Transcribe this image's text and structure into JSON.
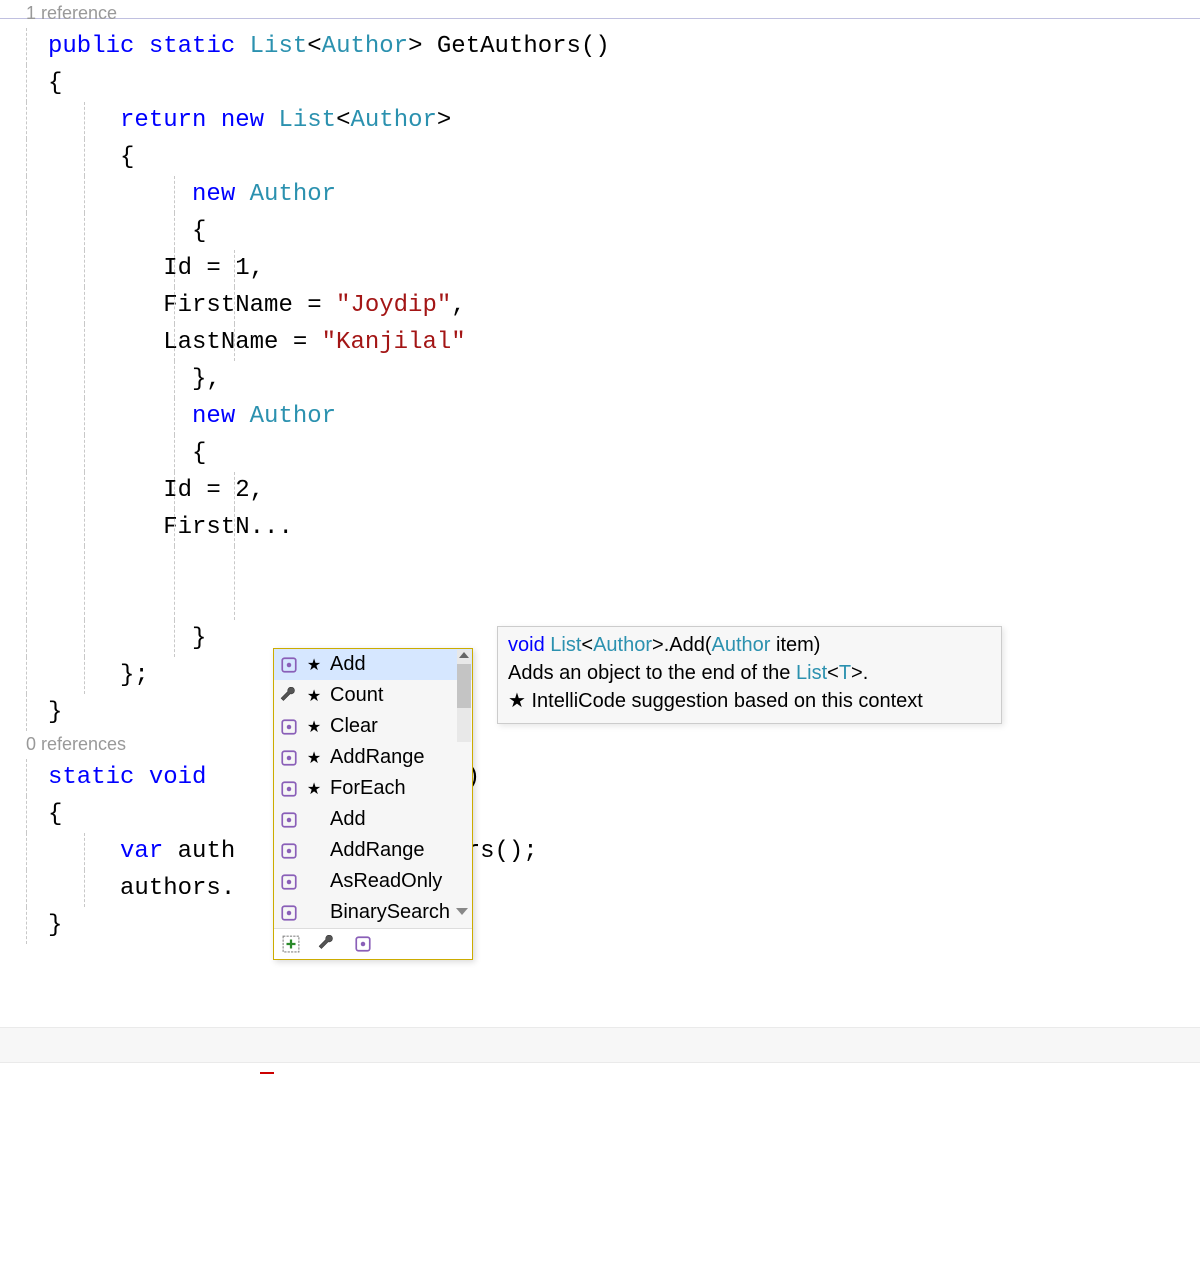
{
  "codelens": {
    "refs1": "1 reference",
    "refs0": "0 references"
  },
  "code": {
    "l1_public": "public",
    "l1_static": "static",
    "l1_list": "List",
    "l1_lt": "<",
    "l1_author": "Author",
    "l1_gt": ">",
    "l1_method": " GetAuthors()",
    "brace_open": "{",
    "brace_close": "}",
    "return": "return",
    "new": "new",
    "list": "List",
    "author": "Author",
    "id1": "        Id = 1,",
    "fn_label": "        FirstName = ",
    "fn_val": "\"Joydip\"",
    "ln_label": "        LastName = ",
    "ln_val": "\"Kanjilal\"",
    "bc_comma": "    },",
    "id2": "        Id = 2,",
    "ellipsis": "        F",
    "inner_close": "    }",
    "semi": "};",
    "static": "static",
    "void": "void",
    "args_bracket": "[] args)",
    "var": "var",
    "auth": " auth",
    "thors": "thors();",
    "authors_dot": "authors."
  },
  "intellisense": {
    "items": [
      {
        "icon": "method",
        "star": true,
        "label": "Add"
      },
      {
        "icon": "wrench",
        "star": true,
        "label": "Count"
      },
      {
        "icon": "method",
        "star": true,
        "label": "Clear"
      },
      {
        "icon": "method",
        "star": true,
        "label": "AddRange"
      },
      {
        "icon": "method",
        "star": true,
        "label": "ForEach"
      },
      {
        "icon": "method",
        "star": false,
        "label": "Add"
      },
      {
        "icon": "method",
        "star": false,
        "label": "AddRange"
      },
      {
        "icon": "method",
        "star": false,
        "label": "AsReadOnly"
      },
      {
        "icon": "method",
        "star": false,
        "label": "BinarySearch"
      }
    ]
  },
  "tooltip": {
    "sig_void": "void",
    "sig_list": "List",
    "sig_lt": "<",
    "sig_author": "Author",
    "sig_gt": ">",
    "sig_add": ".Add(",
    "sig_author2": "Author",
    "sig_item": " item)",
    "desc1_a": "Adds an object to the end of the ",
    "desc1_b": "List",
    "desc1_c": "<",
    "desc1_d": "T",
    "desc1_e": ">",
    "desc1_f": ".",
    "desc2": " IntelliCode suggestion based on this context"
  }
}
